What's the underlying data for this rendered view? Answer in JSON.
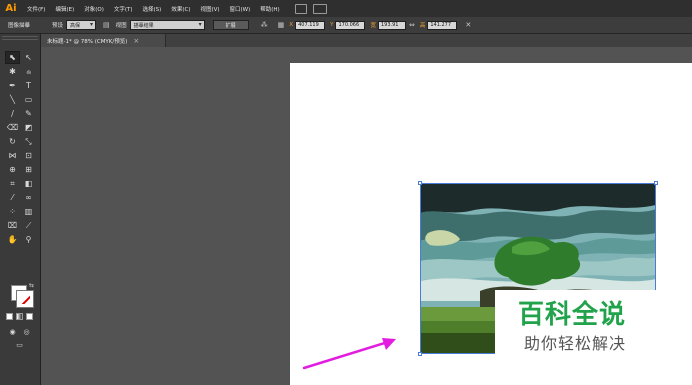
{
  "app": {
    "logo": "Ai"
  },
  "menu": {
    "items": [
      "文件(F)",
      "编辑(E)",
      "对象(O)",
      "文字(T)",
      "选择(S)",
      "效果(C)",
      "视图(V)",
      "窗口(W)",
      "帮助(H)"
    ]
  },
  "control_bar": {
    "title": "图像描摹",
    "preset_label": "预设",
    "preset_value": "高保",
    "view_label": "视图",
    "view_value": "描摹结果",
    "expand_button": "扩展",
    "x_label": "X",
    "x_value": "407.119",
    "y_label": "Y",
    "y_value": "170.066",
    "w_label": "宽",
    "w_value": "193.91",
    "h_label": "高",
    "h_value": "141.277"
  },
  "document": {
    "tab_title": "未标题-1* @ 78% (CMYK/预览)",
    "close_glyph": "×"
  },
  "watermark": {
    "title": "百科全说",
    "subtitle": "助你轻松解决"
  },
  "colors": {
    "accent": "#ff9a00",
    "selection": "#4a7bd8",
    "arrow": "#e21de0",
    "watermark_green": "#21a34b"
  }
}
